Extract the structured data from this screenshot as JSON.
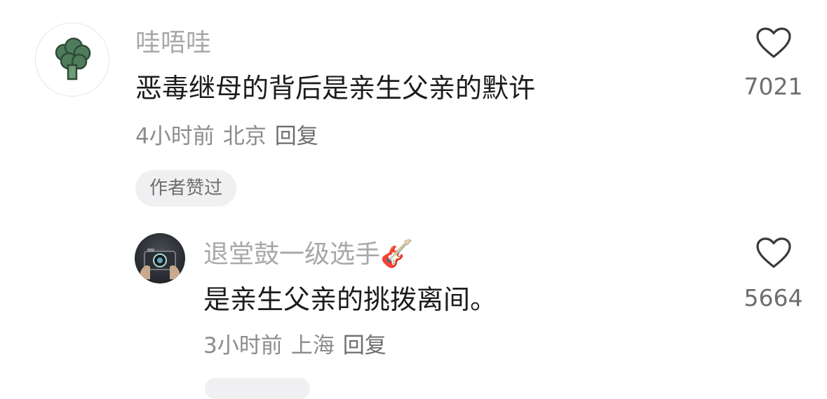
{
  "comments": [
    {
      "username": "哇唔哇",
      "text": "恶毒继母的背后是亲生父亲的默许",
      "time": "4小时前",
      "location": "北京",
      "reply_label": "回复",
      "badge": "作者赞过",
      "like_count": "7021",
      "avatar_icon": "broccoli-icon"
    },
    {
      "username": "退堂鼓一级选手",
      "username_emoji": "🎸",
      "text": "是亲生父亲的挑拨离间。",
      "time": "3小时前",
      "location": "上海",
      "reply_label": "回复",
      "like_count": "5664",
      "avatar_icon": "camera-photo-avatar"
    }
  ],
  "colors": {
    "username": "#a8a8a8",
    "content": "#1c1c1c",
    "meta": "#8c8c8c",
    "badge_bg": "#f0f0f2",
    "broccoli_green": "#4f7d5c"
  }
}
